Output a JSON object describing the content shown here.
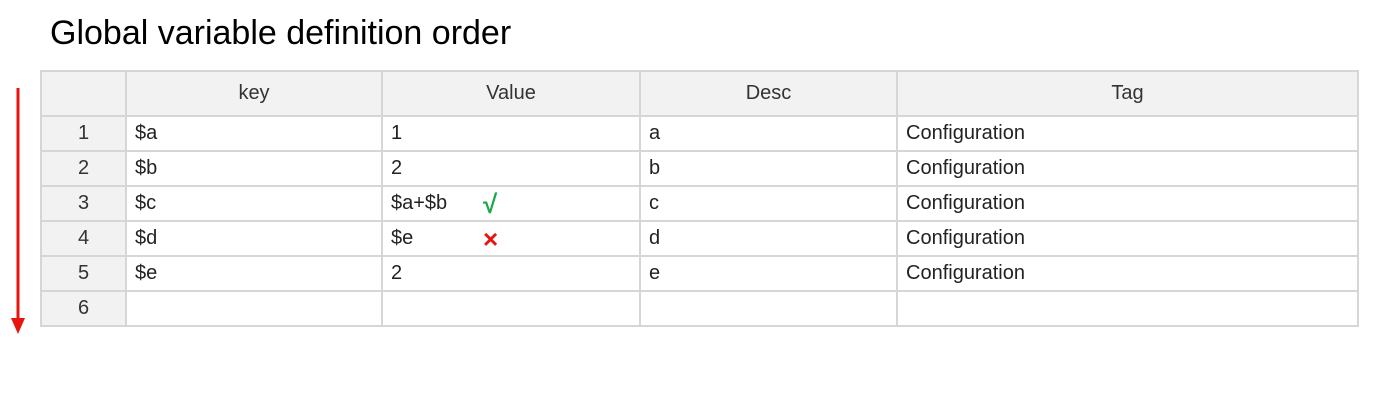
{
  "title": "Global variable definition order",
  "colors": {
    "arrow": "#e8140f",
    "check": "#1aa84a",
    "cross": "#e8140f",
    "header_bg": "#f2f2f2",
    "grid_line": "#d6d6d6"
  },
  "table": {
    "headers": [
      "",
      "key",
      "Value",
      "Desc",
      "Tag"
    ],
    "rows": [
      {
        "num": "1",
        "key": "$a",
        "value": "1",
        "desc": "a",
        "tag": "Configuration",
        "mark": ""
      },
      {
        "num": "2",
        "key": "$b",
        "value": "2",
        "desc": "b",
        "tag": "Configuration",
        "mark": ""
      },
      {
        "num": "3",
        "key": "$c",
        "value": "$a+$b",
        "desc": "c",
        "tag": "Configuration",
        "mark": "√"
      },
      {
        "num": "4",
        "key": "$d",
        "value": "$e",
        "desc": "d",
        "tag": "Configuration",
        "mark": "×"
      },
      {
        "num": "5",
        "key": "$e",
        "value": "2",
        "desc": "e",
        "tag": "Configuration",
        "mark": ""
      },
      {
        "num": "6",
        "key": "",
        "value": "",
        "desc": "",
        "tag": "",
        "mark": ""
      }
    ]
  },
  "icons": {
    "order_arrow": "arrow-down-icon",
    "valid_mark": "check-icon",
    "invalid_mark": "cross-icon"
  }
}
